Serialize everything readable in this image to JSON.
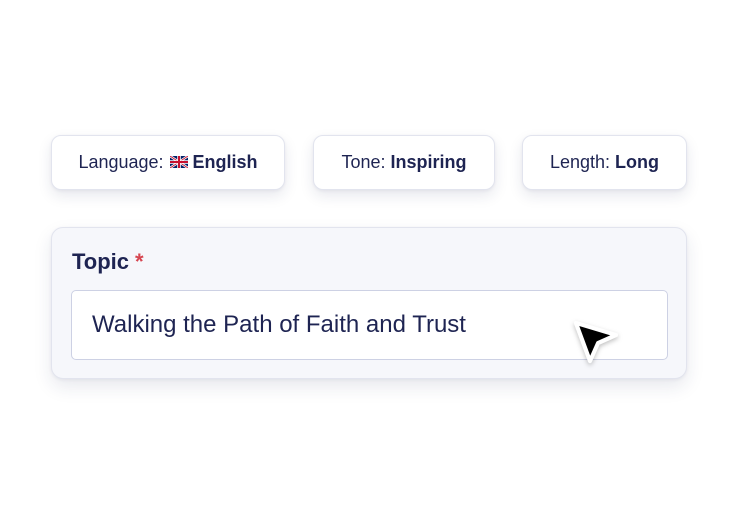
{
  "options": {
    "language": {
      "label": "Language:",
      "value": "English",
      "flag": "uk-flag-icon"
    },
    "tone": {
      "label": "Tone:",
      "value": "Inspiring"
    },
    "length": {
      "label": "Length:",
      "value": "Long"
    }
  },
  "topic": {
    "label": "Topic",
    "required_marker": "*",
    "value": "Walking the Path of Faith and Trust"
  },
  "colors": {
    "text": "#1e2452",
    "required": "#d64550",
    "card_bg": "#f6f7fb",
    "border": "#e2e4ee",
    "cursor": "#000000"
  },
  "icons": {
    "cursor": "mouse-pointer-icon"
  }
}
